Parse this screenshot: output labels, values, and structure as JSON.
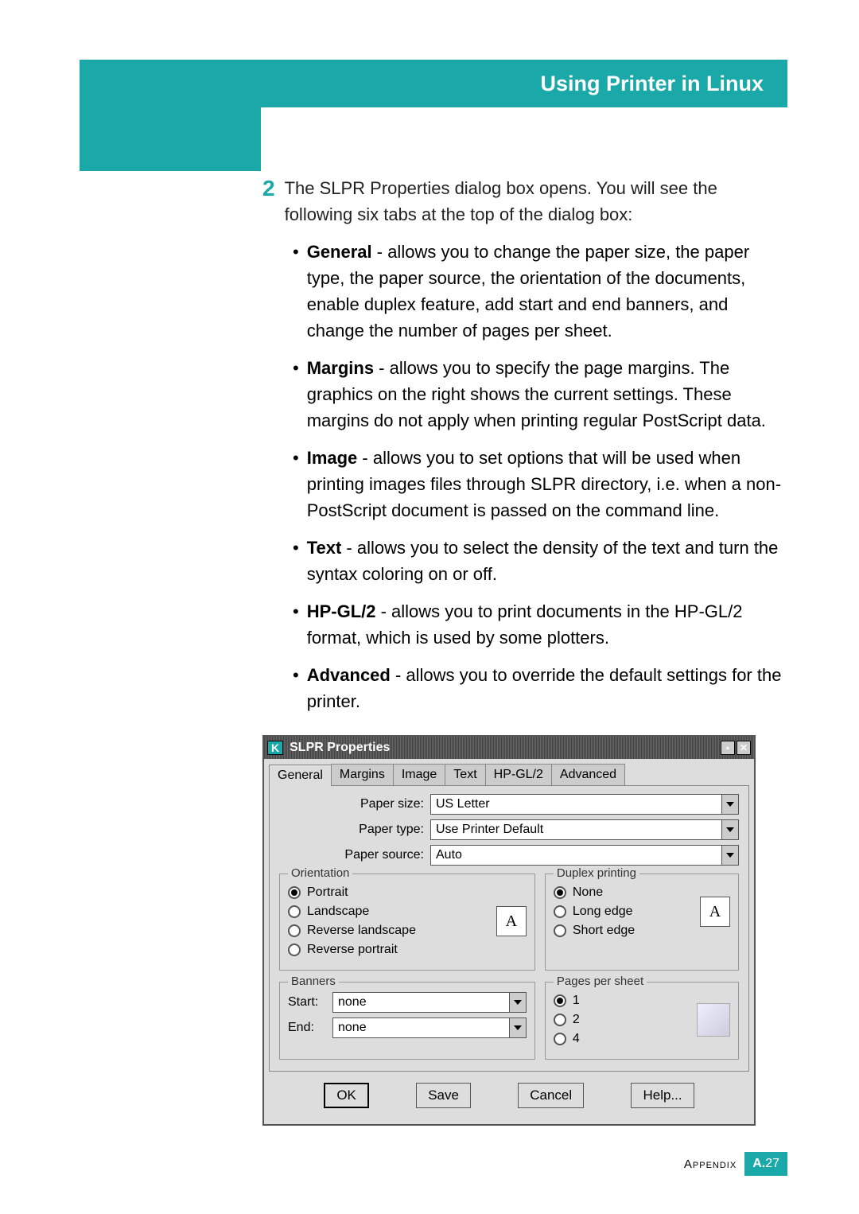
{
  "header": {
    "title": "Using Printer in Linux"
  },
  "step": {
    "number": "2",
    "intro1": "The SLPR Properties dialog box opens. You will see the",
    "intro2": "following six tabs at the top of the dialog box:"
  },
  "bullets": [
    {
      "label": "General",
      "text": " - allows you to change the paper size, the paper type, the paper source, the orientation of the documents, enable duplex feature, add start and end banners, and change the number of pages per sheet."
    },
    {
      "label": "Margins",
      "text": " - allows you to specify the page margins. The graphics on the right shows the current settings. These margins do not apply when printing regular PostScript data."
    },
    {
      "label": "Image",
      "text": " - allows you to set options that will be used when printing images files through SLPR directory, i.e. when a non-PostScript document is passed on the command line."
    },
    {
      "label": "Text",
      "text": " - allows you to select the density of the text and turn the syntax coloring on or off."
    },
    {
      "label": "HP-GL/2",
      "text": " - allows you to print documents in the HP-GL/2 format, which is used by some plotters."
    },
    {
      "label": "Advanced",
      "text": " - allows you to override the default settings for the printer."
    }
  ],
  "dialog": {
    "title": "SLPR Properties",
    "tabs": [
      "General",
      "Margins",
      "Image",
      "Text",
      "HP-GL/2",
      "Advanced"
    ],
    "labels": {
      "paper_size": "Paper size:",
      "paper_type": "Paper type:",
      "paper_source": "Paper source:"
    },
    "values": {
      "paper_size": "US Letter",
      "paper_type": "Use Printer Default",
      "paper_source": "Auto"
    },
    "orientation": {
      "legend": "Orientation",
      "options": [
        "Portrait",
        "Landscape",
        "Reverse landscape",
        "Reverse portrait"
      ],
      "selected": "Portrait",
      "preview": "A"
    },
    "duplex": {
      "legend": "Duplex printing",
      "options": [
        "None",
        "Long edge",
        "Short edge"
      ],
      "selected": "None",
      "preview": "A"
    },
    "banners": {
      "legend": "Banners",
      "start_label": "Start:",
      "end_label": "End:",
      "start": "none",
      "end": "none"
    },
    "pps": {
      "legend": "Pages per sheet",
      "options": [
        "1",
        "2",
        "4"
      ],
      "selected": "1"
    },
    "buttons": {
      "ok": "OK",
      "save": "Save",
      "cancel": "Cancel",
      "help": "Help..."
    }
  },
  "footer": {
    "label": "Appendix",
    "page_prefix": "A.",
    "page": "27"
  }
}
